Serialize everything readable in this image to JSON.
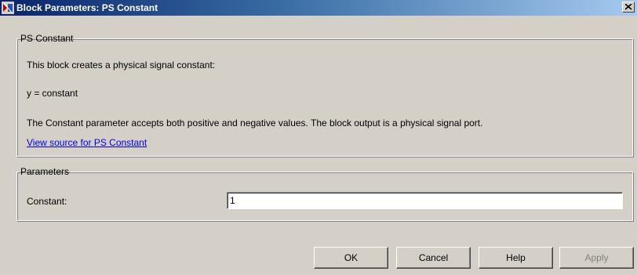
{
  "window": {
    "title": "Block Parameters: PS Constant",
    "close_glyph": "×"
  },
  "description_group": {
    "legend": "PS Constant",
    "line1": "This block creates a physical signal constant:",
    "line2": "y = constant",
    "line3": "The Constant parameter accepts both positive and negative values. The block output is a physical signal port.",
    "link": "View source for PS Constant"
  },
  "parameters_group": {
    "legend": "Parameters",
    "constant_label": "Constant:",
    "constant_value": "1"
  },
  "buttons": {
    "ok": "OK",
    "cancel": "Cancel",
    "help": "Help",
    "apply": "Apply"
  },
  "icons": {
    "window_icon": "simulink-block-icon",
    "close_icon": "close-icon"
  },
  "colors": {
    "titlebar_start": "#0a246a",
    "titlebar_end": "#a6caf0",
    "dialog_bg": "#d4d0c8",
    "link": "#0000ee",
    "disabled_text": "#808080"
  }
}
